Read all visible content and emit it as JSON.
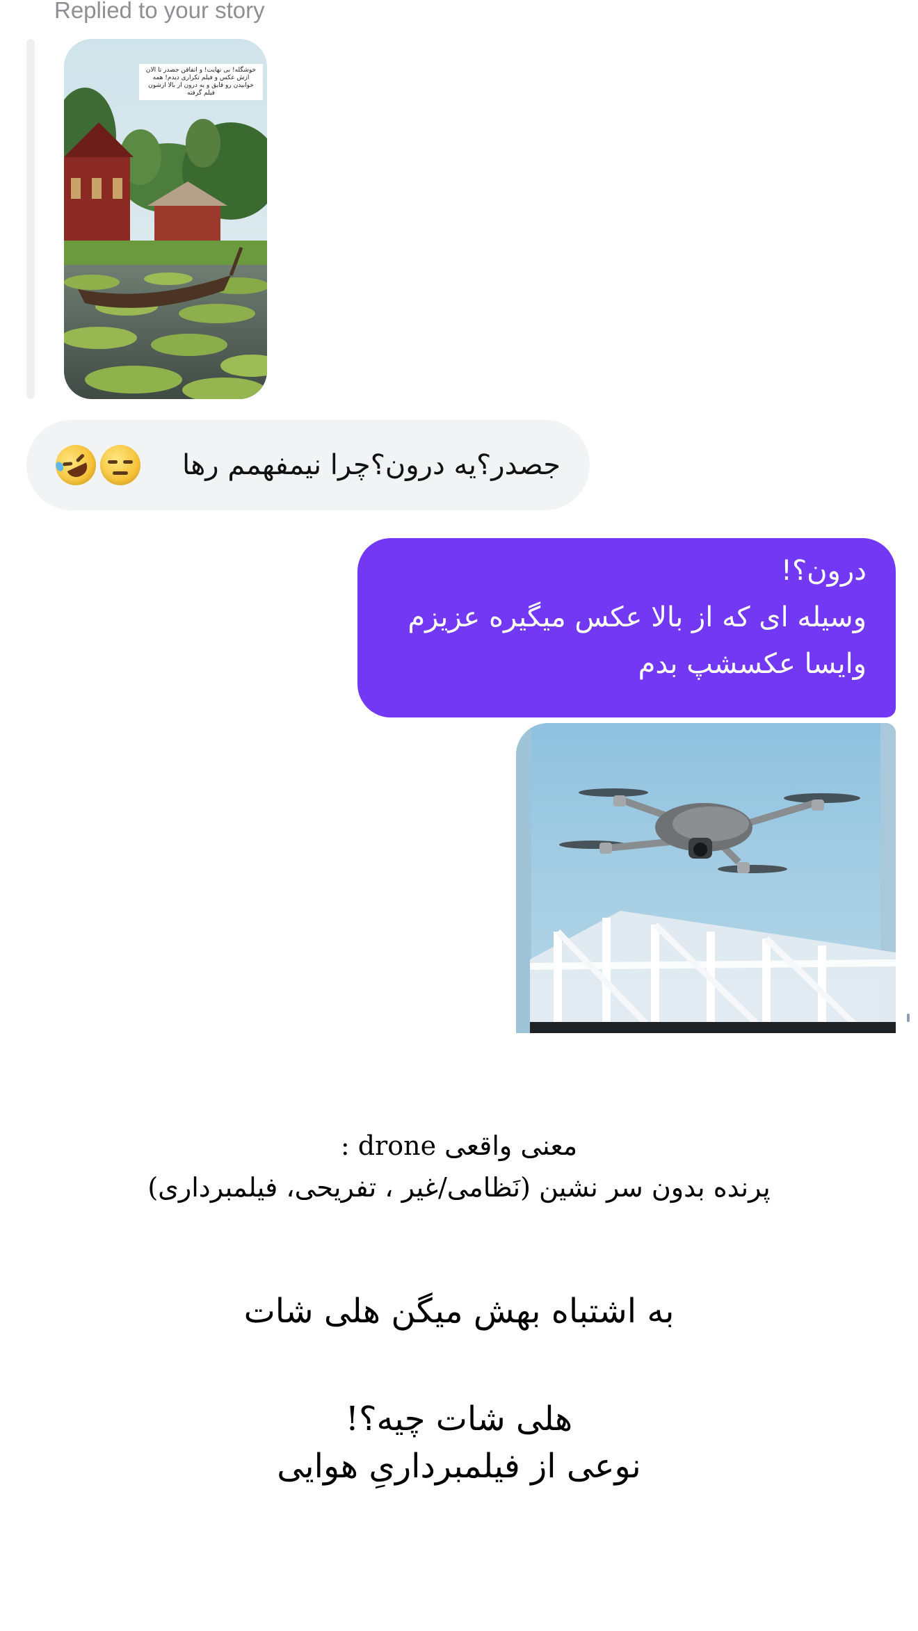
{
  "thread": {
    "replied_label": "Replied to your story",
    "story_caption": "خوشگله! بی نهایت! و اتفاقن جصدر تا الان ازش عکس و فیلم تکراری دیدم! همه خوابیدن رو قایق و یه درون از بالا ازشون فیلم گرفته",
    "incoming_message": "جصدر؟یه درون؟چرا نیمفهمم رها",
    "incoming_emojis": [
      "expressionless-face-icon",
      "rolling-on-the-floor-laughing-icon"
    ],
    "outgoing_lines": [
      "درون؟!",
      "وسیله ای که از بالا عکس میگیره عزیزم",
      "وایسا عکسشپ بدم"
    ]
  },
  "caption": {
    "line1": "معنی واقعی drone :",
    "line2": "پرنده بدون سر نشین (نَظامی/غیر ، تفریحی، فیلمبرداری)",
    "line3": "به اشتباه بهش میگن هلی شات",
    "line4": "هلی شات چیه؟!",
    "line5": "نوعی از فیلمبرداریِ هوایی"
  },
  "colors": {
    "outgoing_bubble": "#7238f4",
    "incoming_bubble": "#f2f3f5",
    "replied_label": "#8e8e93"
  }
}
